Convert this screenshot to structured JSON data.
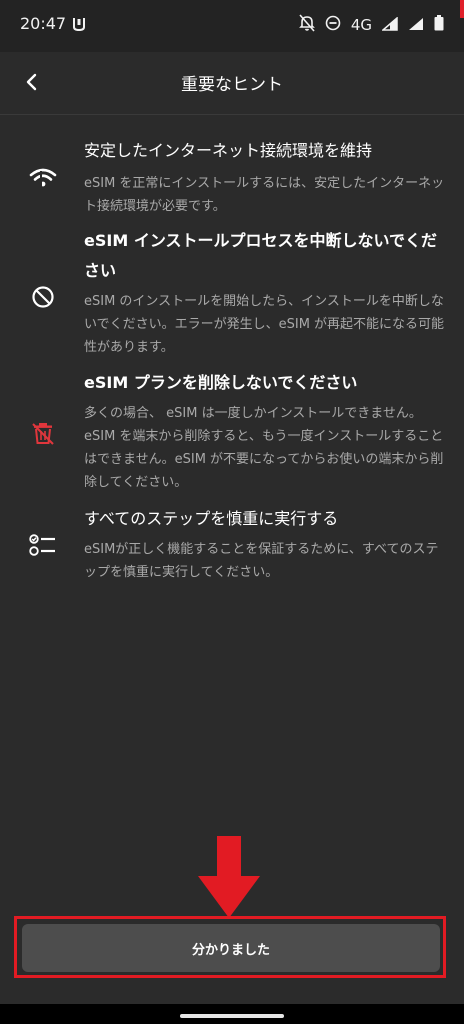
{
  "status": {
    "time": "20:47",
    "network": "4G",
    "icons": [
      "mi-icon",
      "notifications-off-icon",
      "do-not-disturb-icon",
      "signal-icon",
      "signal-icon",
      "battery-icon"
    ]
  },
  "header": {
    "title": "重要なヒント",
    "back_icon": "chevron-left-icon"
  },
  "tips": [
    {
      "icon": "wifi-off-icon",
      "title": "安定したインターネット接続環境を維持",
      "body": "eSIM を正常にインストールするには、安定したインターネット接続環境が必要です。"
    },
    {
      "icon": "block-icon",
      "title": "eSIM インストールプロセスを中断しないでください",
      "body": "eSIM のインストールを開始したら、インストールを中断しないでください。エラーが発生し、eSIM が再起不能になる可能性があります。"
    },
    {
      "icon": "trash-off-icon",
      "title": "eSIM プランを削除しないでください",
      "body": "多くの場合、 eSIM は一度しかインストールできません。eSIM を端末から削除すると、もう一度インストールすることはできません。eSIM が不要になってからお使いの端末から削除してください。"
    },
    {
      "icon": "checklist-icon",
      "title": "すべてのステップを慎重に実行する",
      "body": "eSIMが正しく機能することを保証するために、すべてのステップを慎重に実行してください。"
    }
  ],
  "colors": {
    "background": "#2b2b2b",
    "accent_red": "#e21b23",
    "button": "#4d4d4d",
    "body_text": "#a9a9a9"
  },
  "confirm_button": {
    "label": "分かりました"
  }
}
